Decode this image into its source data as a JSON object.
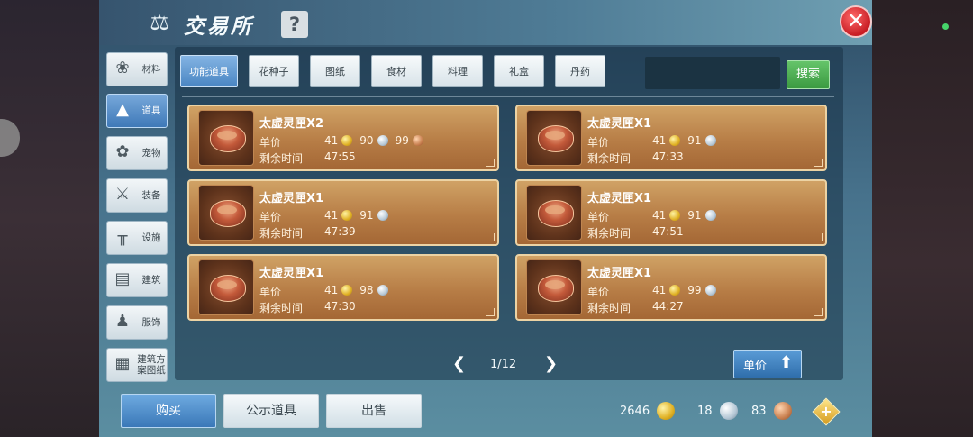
{
  "window": {
    "title": "交易所",
    "help_symbol": "?",
    "close_symbol": "✕"
  },
  "categories": [
    {
      "label": "材料",
      "icon": "materials-icon",
      "glyph": "❀",
      "active": false
    },
    {
      "label": "道具",
      "icon": "props-icon",
      "glyph": "▲",
      "active": true
    },
    {
      "label": "宠物",
      "icon": "pet-paw-icon",
      "glyph": "✿",
      "active": false
    },
    {
      "label": "装备",
      "icon": "equipment-icon",
      "glyph": "⚔",
      "active": false
    },
    {
      "label": "设施",
      "icon": "facility-icon",
      "glyph": "╥",
      "active": false
    },
    {
      "label": "建筑",
      "icon": "building-icon",
      "glyph": "▤",
      "active": false
    },
    {
      "label": "服饰",
      "icon": "clothing-icon",
      "glyph": "♟",
      "active": false
    },
    {
      "label": "建筑方案图纸",
      "icon": "blueprint-icon",
      "glyph": "▦",
      "active": false
    }
  ],
  "tabs": [
    {
      "label": "功能道具",
      "active": true
    },
    {
      "label": "花种子",
      "active": false
    },
    {
      "label": "图纸",
      "active": false
    },
    {
      "label": "食材",
      "active": false
    },
    {
      "label": "料理",
      "active": false
    },
    {
      "label": "礼盒",
      "active": false
    },
    {
      "label": "丹药",
      "active": false
    }
  ],
  "search": {
    "button_label": "搜索"
  },
  "labels": {
    "unit_price": "单价",
    "time_left": "剩余时间"
  },
  "listings": [
    {
      "name": "太虚灵匣X2",
      "gold": "41",
      "silver": "90",
      "copper": "99",
      "time": "47:55"
    },
    {
      "name": "太虚灵匣X1",
      "gold": "41",
      "silver": "91",
      "copper": null,
      "time": "47:33"
    },
    {
      "name": "太虚灵匣X1",
      "gold": "41",
      "silver": "91",
      "copper": null,
      "time": "47:39"
    },
    {
      "name": "太虚灵匣X1",
      "gold": "41",
      "silver": "91",
      "copper": null,
      "time": "47:51"
    },
    {
      "name": "太虚灵匣X1",
      "gold": "41",
      "silver": "98",
      "copper": null,
      "time": "47:30"
    },
    {
      "name": "太虚灵匣X1",
      "gold": "41",
      "silver": "99",
      "copper": null,
      "time": "44:27"
    }
  ],
  "pagination": {
    "text": "1/12",
    "prev": "❮",
    "next": "❯"
  },
  "sort": {
    "label": "单价",
    "icon": "sort-arrow-icon"
  },
  "bottom_buttons": {
    "buy": "购买",
    "public_items": "公示道具",
    "sell": "出售"
  },
  "wallet": {
    "gold": "2646",
    "silver": "18",
    "copper": "83",
    "plus": "+"
  },
  "colors": {
    "accent_blue": "#4a86c3",
    "search_green": "#3b9a41",
    "card_gold": "#b77d46",
    "close_red": "#c81d24"
  }
}
